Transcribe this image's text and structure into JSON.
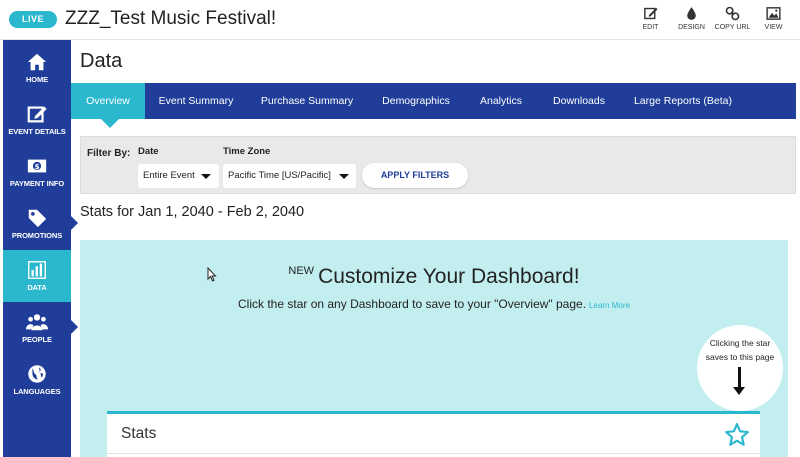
{
  "topbar": {
    "live_label": "LIVE",
    "event_title": "ZZZ_Test Music Festival!",
    "actions": [
      {
        "label": "EDIT",
        "icon": "edit-icon"
      },
      {
        "label": "DESIGN",
        "icon": "droplet-icon"
      },
      {
        "label": "COPY URL",
        "icon": "link-icon"
      },
      {
        "label": "VIEW",
        "icon": "image-icon"
      }
    ]
  },
  "sidebar": {
    "items": [
      {
        "label": "HOME",
        "icon": "home-icon"
      },
      {
        "label": "EVENT DETAILS",
        "icon": "edit-icon"
      },
      {
        "label": "PAYMENT INFO",
        "icon": "dollar-bill-icon"
      },
      {
        "label": "PROMOTIONS",
        "icon": "tag-icon"
      },
      {
        "label": "DATA",
        "icon": "bar-chart-icon",
        "active": true
      },
      {
        "label": "PEOPLE",
        "icon": "people-icon"
      },
      {
        "label": "LANGUAGES",
        "icon": "globe-icon"
      }
    ]
  },
  "page": {
    "title": "Data"
  },
  "tabs": [
    {
      "label": "Overview",
      "active": true
    },
    {
      "label": "Event Summary"
    },
    {
      "label": "Purchase Summary"
    },
    {
      "label": "Demographics"
    },
    {
      "label": "Analytics"
    },
    {
      "label": "Downloads"
    },
    {
      "label": "Large Reports (Beta)"
    }
  ],
  "filters": {
    "filter_by_label": "Filter By:",
    "date_label": "Date",
    "date_value": "Entire Event",
    "timezone_label": "Time Zone",
    "timezone_value": "Pacific Time [US/Pacific]",
    "apply_label": "APPLY FILTERS"
  },
  "stats_range": "Stats for Jan 1, 2040 - Feb 2, 2040",
  "promo": {
    "new_label": "NEW",
    "heading": "Customize Your Dashboard!",
    "subtext": "Click the star on any Dashboard to save to your \"Overview\" page.",
    "learn_more": "Learn More",
    "tip_line1": "Clicking the star",
    "tip_line2": "saves to this page"
  },
  "stats_card": {
    "title": "Stats"
  },
  "colors": {
    "navy": "#1f3d99",
    "teal": "#2bb8cf",
    "panel": "#c3eef0"
  }
}
